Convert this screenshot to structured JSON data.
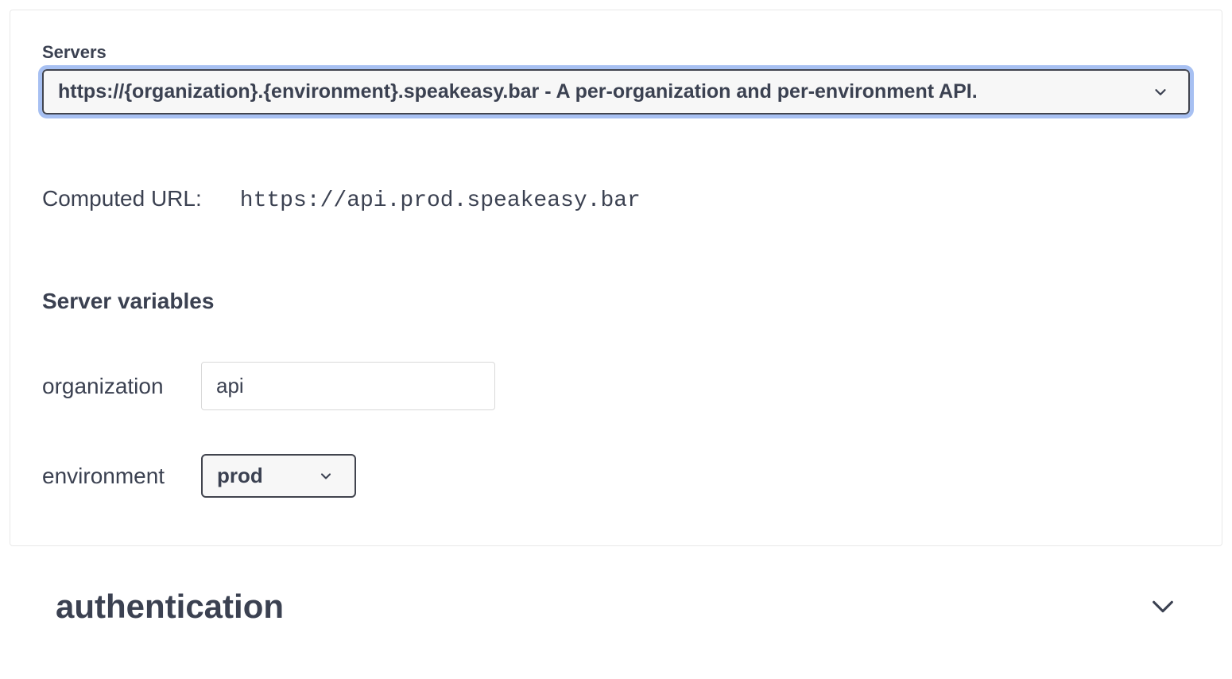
{
  "servers": {
    "label": "Servers",
    "selected": "https://{organization}.{environment}.speakeasy.bar - A per-organization and per-environment API."
  },
  "computed": {
    "label": "Computed URL:",
    "value": "https://api.prod.speakeasy.bar"
  },
  "variables": {
    "heading": "Server variables",
    "organization": {
      "label": "organization",
      "value": "api"
    },
    "environment": {
      "label": "environment",
      "value": "prod"
    }
  },
  "sections": {
    "authentication": {
      "title": "authentication"
    }
  }
}
